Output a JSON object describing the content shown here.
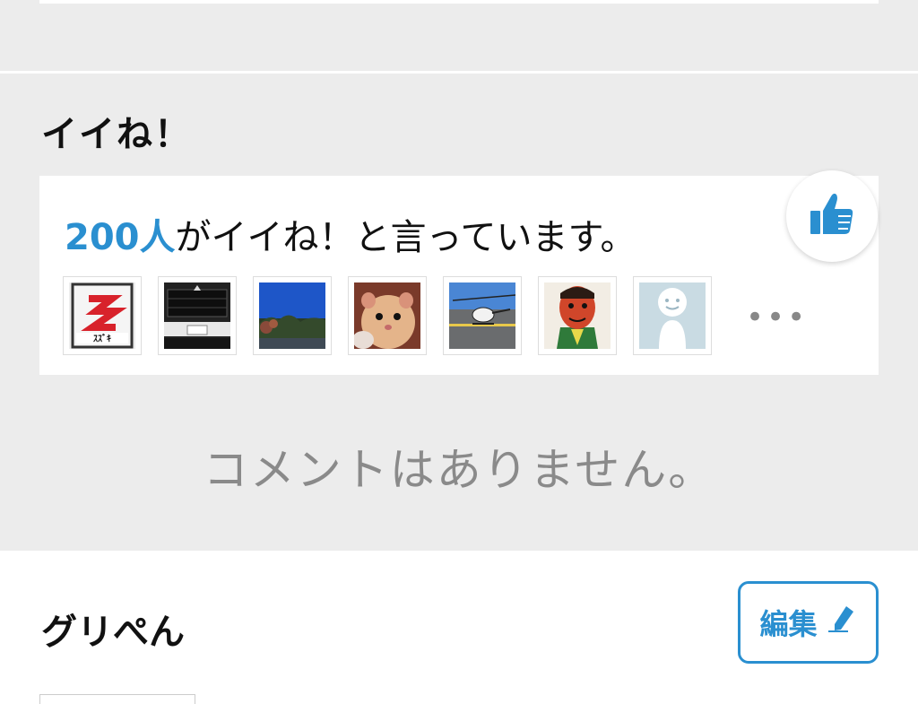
{
  "likes_section": {
    "title": "イイね！",
    "count": "200人",
    "count_suffix": "がイイね！と言っています。",
    "more": "•••",
    "avatars": [
      {
        "name": "suzuki-logo"
      },
      {
        "name": "truck-front"
      },
      {
        "name": "landscape"
      },
      {
        "name": "hamster"
      },
      {
        "name": "helicopter"
      },
      {
        "name": "painted-face"
      },
      {
        "name": "default-avatar"
      }
    ]
  },
  "comments": {
    "empty_text": "コメントはありません。"
  },
  "profile": {
    "name": "グリぺん",
    "edit_label": "編集"
  },
  "colors": {
    "accent": "#2a8fd0",
    "background": "#ececec"
  }
}
